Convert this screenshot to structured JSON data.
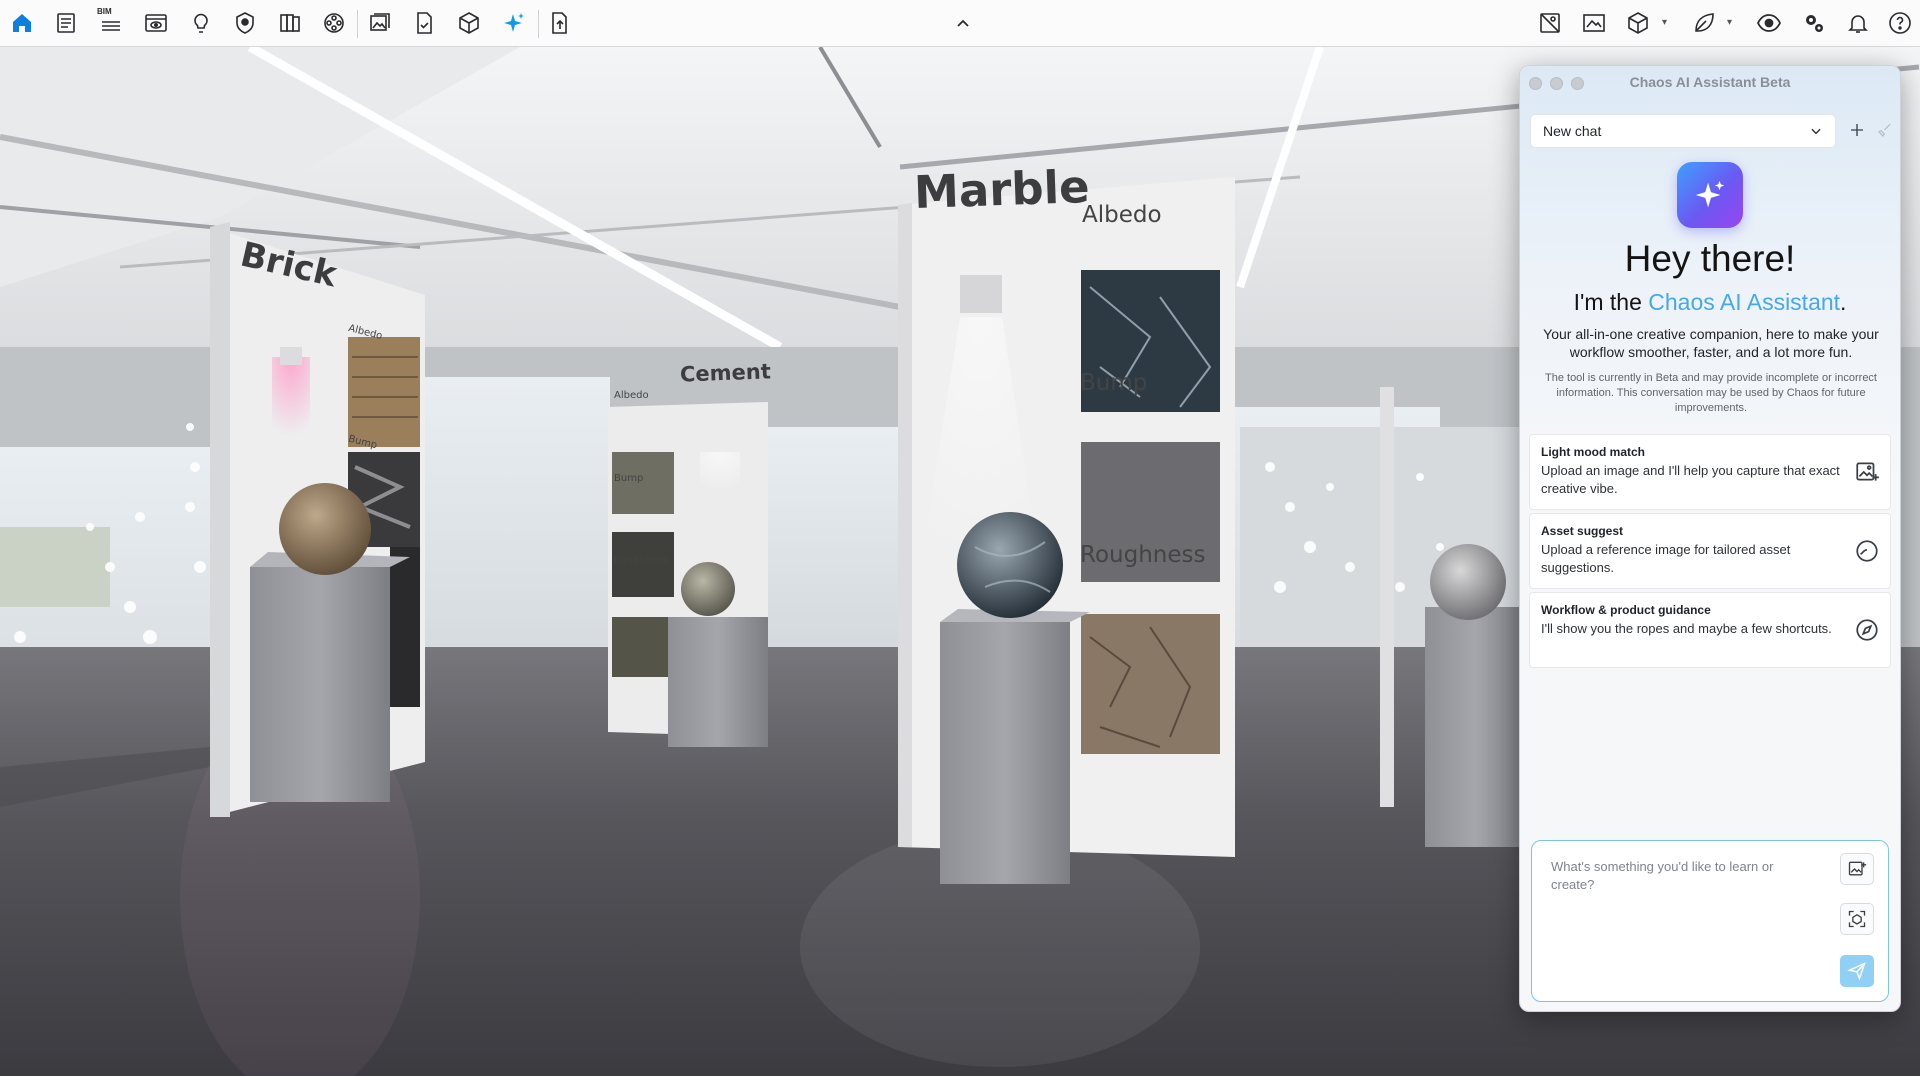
{
  "toolbar": {
    "left_icons": [
      "home-icon",
      "document-icon",
      "bim-icon",
      "render-window-icon",
      "lightbulb-icon",
      "material-shield-icon",
      "library-icon",
      "film-reel-icon",
      "image-gallery-icon",
      "file-check-icon",
      "cube-icon",
      "ai-sparkle-icon",
      "page-export-icon"
    ],
    "bim_label": "BIM",
    "collapse_icon": "chevron-up-icon",
    "right_icons": [
      "scene-warning-icon",
      "frame-buffer-icon",
      "cube-dropdown-icon",
      "leaf-dropdown-icon",
      "eye-icon",
      "settings-icon",
      "bell-icon",
      "help-icon"
    ]
  },
  "scene": {
    "signs": {
      "brick": "Brick",
      "cement": "Cement",
      "marble": "Marble"
    },
    "texture_labels": {
      "albedo": "Albedo",
      "bump": "Bump",
      "roughness": "Roughness"
    }
  },
  "assistant": {
    "window_title": "Chaos AI Assistant Beta",
    "chat_selector": "New chat",
    "greeting": "Hey there!",
    "intro_prefix": "I'm the ",
    "intro_brand": "Chaos AI Assistant",
    "intro_suffix": ".",
    "description": "Your all-in-one creative companion, here to make your workflow smoother, faster, and a lot more fun.",
    "disclaimer": "The tool is currently in Beta and may provide incomplete or incorrect information. This conversation may be used by Chaos for future improvements.",
    "suggestions": [
      {
        "title": "Light mood match",
        "text": "Upload an image and I'll help you capture that exact creative vibe.",
        "icon": "image-add-icon"
      },
      {
        "title": "Asset suggest",
        "text": "Upload a reference image for tailored asset suggestions.",
        "icon": "circle-icon"
      },
      {
        "title": "Workflow & product guidance",
        "text": "I'll show you the ropes and maybe a few shortcuts.",
        "icon": "compass-icon"
      }
    ],
    "input_placeholder": "What's something you'd like to learn or create?",
    "colors": {
      "accent": "#45a8ea",
      "send": "#8fd0f4",
      "input_border": "#7cc3ea"
    }
  }
}
